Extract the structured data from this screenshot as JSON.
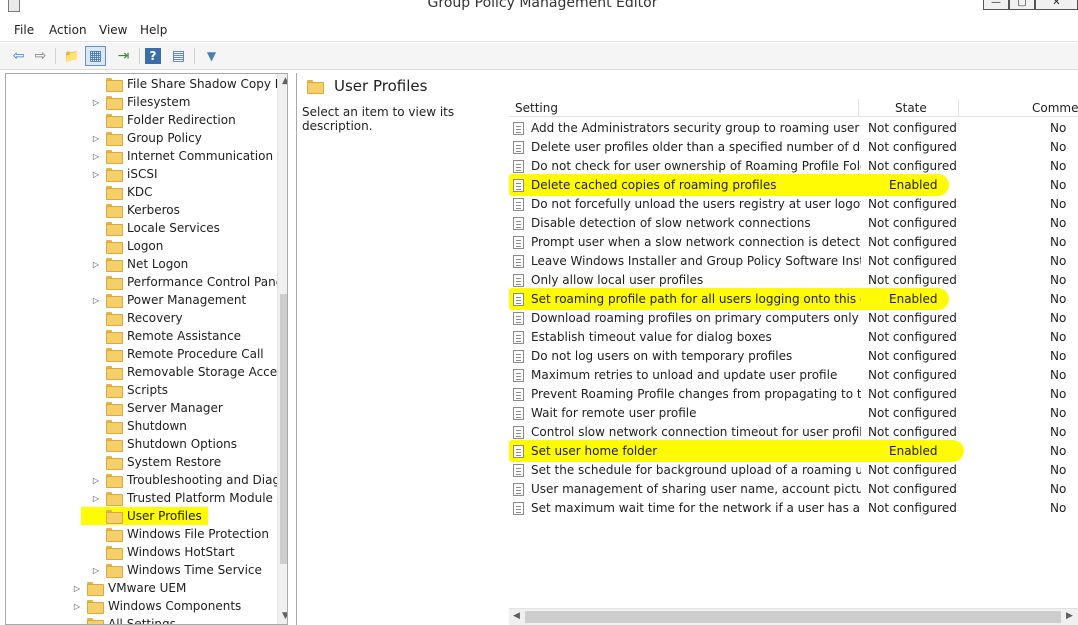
{
  "window": {
    "title": "Group Policy Management Editor"
  },
  "menu": [
    "File",
    "Action",
    "View",
    "Help"
  ],
  "toolbar": [
    {
      "name": "back-arrow-icon",
      "glyph": "⇦"
    },
    {
      "name": "forward-arrow-icon",
      "glyph": "⇨"
    },
    {
      "name": "up-folder-icon",
      "glyph": "📁"
    },
    {
      "name": "show-hide-tree-icon",
      "glyph": "▦"
    },
    {
      "name": "export-list-icon",
      "glyph": "⇥"
    },
    {
      "name": "help-icon",
      "glyph": "?"
    },
    {
      "name": "properties-icon",
      "glyph": "▤"
    },
    {
      "name": "filter-icon",
      "glyph": "▼"
    }
  ],
  "tree": {
    "items": [
      {
        "label": "File Share Shadow Copy Pro",
        "expandable": false,
        "highlight": false,
        "level": 1
      },
      {
        "label": "Filesystem",
        "expandable": true,
        "highlight": false,
        "level": 1
      },
      {
        "label": "Folder Redirection",
        "expandable": false,
        "highlight": false,
        "level": 1
      },
      {
        "label": "Group Policy",
        "expandable": true,
        "highlight": false,
        "level": 1
      },
      {
        "label": "Internet Communication M",
        "expandable": true,
        "highlight": false,
        "level": 1
      },
      {
        "label": "iSCSI",
        "expandable": true,
        "highlight": false,
        "level": 1
      },
      {
        "label": "KDC",
        "expandable": false,
        "highlight": false,
        "level": 1
      },
      {
        "label": "Kerberos",
        "expandable": false,
        "highlight": false,
        "level": 1
      },
      {
        "label": "Locale Services",
        "expandable": false,
        "highlight": false,
        "level": 1
      },
      {
        "label": "Logon",
        "expandable": false,
        "highlight": false,
        "level": 1
      },
      {
        "label": "Net Logon",
        "expandable": true,
        "highlight": false,
        "level": 1
      },
      {
        "label": "Performance Control Panel",
        "expandable": false,
        "highlight": false,
        "level": 1
      },
      {
        "label": "Power Management",
        "expandable": true,
        "highlight": false,
        "level": 1
      },
      {
        "label": "Recovery",
        "expandable": false,
        "highlight": false,
        "level": 1
      },
      {
        "label": "Remote Assistance",
        "expandable": false,
        "highlight": false,
        "level": 1
      },
      {
        "label": "Remote Procedure Call",
        "expandable": false,
        "highlight": false,
        "level": 1
      },
      {
        "label": "Removable Storage Access",
        "expandable": false,
        "highlight": false,
        "level": 1
      },
      {
        "label": "Scripts",
        "expandable": false,
        "highlight": false,
        "level": 1
      },
      {
        "label": "Server Manager",
        "expandable": false,
        "highlight": false,
        "level": 1
      },
      {
        "label": "Shutdown",
        "expandable": false,
        "highlight": false,
        "level": 1
      },
      {
        "label": "Shutdown Options",
        "expandable": false,
        "highlight": false,
        "level": 1
      },
      {
        "label": "System Restore",
        "expandable": false,
        "highlight": false,
        "level": 1
      },
      {
        "label": "Troubleshooting and Diagn",
        "expandable": true,
        "highlight": false,
        "level": 1
      },
      {
        "label": "Trusted Platform Module Se",
        "expandable": true,
        "highlight": false,
        "level": 1
      },
      {
        "label": "User Profiles",
        "expandable": false,
        "highlight": true,
        "level": 1
      },
      {
        "label": "Windows File Protection",
        "expandable": false,
        "highlight": false,
        "level": 1
      },
      {
        "label": "Windows HotStart",
        "expandable": false,
        "highlight": false,
        "level": 1
      },
      {
        "label": "Windows Time Service",
        "expandable": true,
        "highlight": false,
        "level": 1
      },
      {
        "label": "VMware UEM",
        "expandable": true,
        "highlight": false,
        "level": 0
      },
      {
        "label": "Windows Components",
        "expandable": true,
        "highlight": false,
        "level": 0
      },
      {
        "label": "All Settings",
        "expandable": false,
        "highlight": false,
        "level": 0
      }
    ]
  },
  "right": {
    "title": "User Profiles",
    "description": "Select an item to view its description.",
    "columns": [
      "Setting",
      "State",
      "Commen"
    ],
    "rows": [
      {
        "setting": "Add the Administrators security group to roaming user profi...",
        "state": "Not configured",
        "comment": "No",
        "highlight": false
      },
      {
        "setting": "Delete user profiles older than a specified number of days o...",
        "state": "Not configured",
        "comment": "No",
        "highlight": false
      },
      {
        "setting": "Do not check for user ownership of Roaming Profile Folders",
        "state": "Not configured",
        "comment": "No",
        "highlight": false
      },
      {
        "setting": "Delete cached copies of roaming profiles",
        "state": "Enabled",
        "comment": "No",
        "highlight": true
      },
      {
        "setting": "Do not forcefully unload the users registry at user logoff",
        "state": "Not configured",
        "comment": "No",
        "highlight": false
      },
      {
        "setting": "Disable detection of slow network connections",
        "state": "Not configured",
        "comment": "No",
        "highlight": false
      },
      {
        "setting": "Prompt user when a slow network connection is detected",
        "state": "Not configured",
        "comment": "No",
        "highlight": false
      },
      {
        "setting": "Leave Windows Installer and Group Policy Software Installati...",
        "state": "Not configured",
        "comment": "No",
        "highlight": false
      },
      {
        "setting": "Only allow local user profiles",
        "state": "Not configured",
        "comment": "No",
        "highlight": false
      },
      {
        "setting": "Set roaming profile path for all users logging onto this com...",
        "state": "Enabled",
        "comment": "No",
        "highlight": true
      },
      {
        "setting": "Download roaming profiles on primary computers only",
        "state": "Not configured",
        "comment": "No",
        "highlight": false
      },
      {
        "setting": "Establish timeout value for dialog boxes",
        "state": "Not configured",
        "comment": "No",
        "highlight": false
      },
      {
        "setting": "Do not log users on with temporary profiles",
        "state": "Not configured",
        "comment": "No",
        "highlight": false
      },
      {
        "setting": "Maximum retries to unload and update user profile",
        "state": "Not configured",
        "comment": "No",
        "highlight": false
      },
      {
        "setting": "Prevent Roaming Profile changes from propagating to the s...",
        "state": "Not configured",
        "comment": "No",
        "highlight": false
      },
      {
        "setting": "Wait for remote user profile",
        "state": "Not configured",
        "comment": "No",
        "highlight": false
      },
      {
        "setting": "Control slow network connection timeout for user profiles",
        "state": "Not configured",
        "comment": "No",
        "highlight": false
      },
      {
        "setting": "Set user home folder",
        "state": "Enabled",
        "comment": "No",
        "highlight": true
      },
      {
        "setting": "Set the schedule for background upload of a roaming user p...",
        "state": "Not configured",
        "comment": "No",
        "highlight": false
      },
      {
        "setting": "User management of sharing user name, account picture, a...",
        "state": "Not configured",
        "comment": "No",
        "highlight": false
      },
      {
        "setting": "Set maximum wait time for the network if a user has a roami...",
        "state": "Not configured",
        "comment": "No",
        "highlight": false
      }
    ]
  },
  "colors": {
    "highlight": "#fffb05",
    "folder": "#f5cf69",
    "border": "#a9a9a9"
  }
}
